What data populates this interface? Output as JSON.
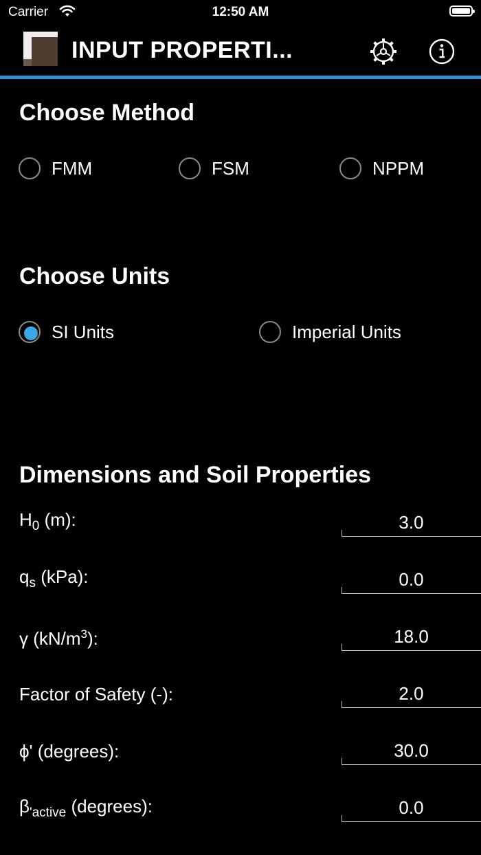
{
  "status_bar": {
    "carrier": "Carrier",
    "time": "12:50 AM"
  },
  "header": {
    "title": "INPUT PROPERTI...",
    "settings_icon": "gear-icon",
    "info_icon": "info-icon"
  },
  "accent_color": "#2b93d1",
  "method": {
    "title": "Choose Method",
    "options": [
      {
        "label": "FMM",
        "selected": false
      },
      {
        "label": "FSM",
        "selected": false
      },
      {
        "label": "NPPM",
        "selected": false
      }
    ]
  },
  "units": {
    "title": "Choose Units",
    "options": [
      {
        "label": "SI Units",
        "selected": true
      },
      {
        "label": "Imperial Units",
        "selected": false
      }
    ]
  },
  "properties": {
    "title": "Dimensions and Soil Properties",
    "items": [
      {
        "label_main": "H",
        "label_sub": "0",
        "label_rest": " (m):",
        "value": "3.0"
      },
      {
        "label_main": "q",
        "label_sub": "s",
        "label_rest": " (kPa):",
        "value": "0.0"
      },
      {
        "label_main": "γ (kN/m",
        "label_sup": "3",
        "label_rest": "):",
        "value": "18.0"
      },
      {
        "label_main": "Factor of Safety (-):",
        "value": "2.0"
      },
      {
        "label_main": "ϕ' (degrees):",
        "value": "30.0"
      },
      {
        "label_main": "β",
        "label_sub": "'active",
        "label_rest": " (degrees):",
        "value": "0.0"
      }
    ]
  }
}
